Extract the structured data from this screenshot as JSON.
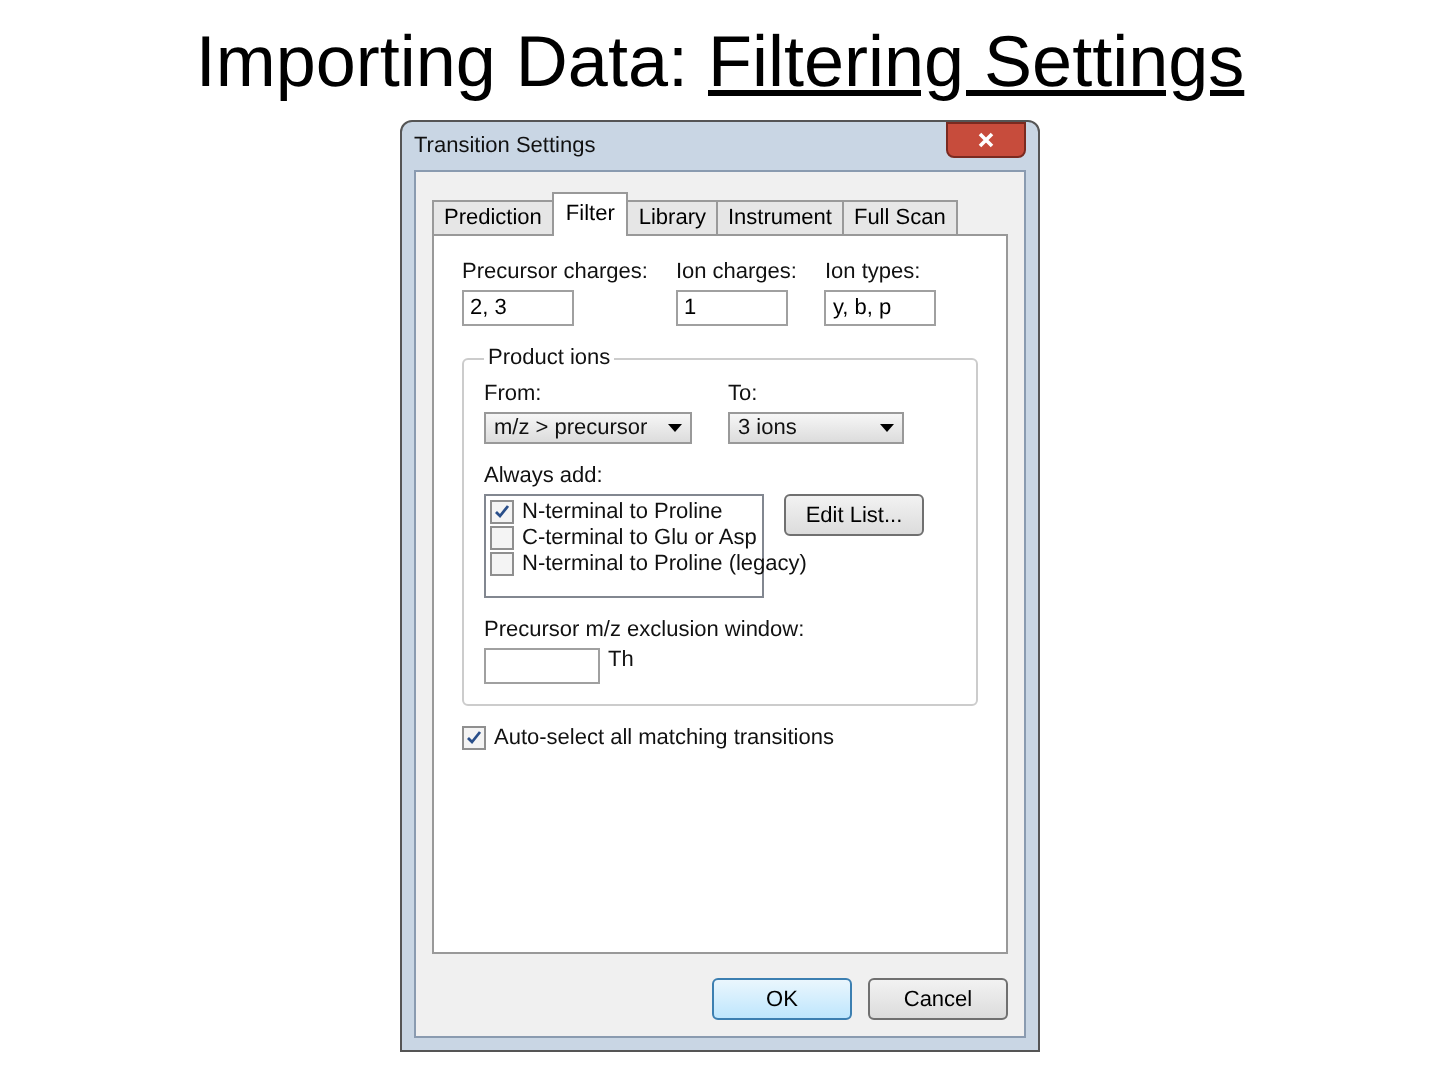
{
  "slide_title": {
    "text": "Importing Data:",
    "link": "Filtering Settings"
  },
  "dialog": {
    "title": "Transition Settings",
    "tabs": [
      {
        "label": "Prediction",
        "selected": false
      },
      {
        "label": "Filter",
        "selected": true
      },
      {
        "label": "Library",
        "selected": false
      },
      {
        "label": "Instrument",
        "selected": false
      },
      {
        "label": "Full Scan",
        "selected": false
      }
    ],
    "fields": [
      {
        "label": "Precursor charges:",
        "value": "2, 3"
      },
      {
        "label": "Ion charges:",
        "value": "1"
      },
      {
        "label": "Ion types:",
        "value": "y, b, p"
      }
    ],
    "product_ions": {
      "title": "Product ions",
      "from": {
        "label": "From:",
        "value": "m/z > precursor"
      },
      "to": {
        "label": "To:",
        "value": "3 ions"
      },
      "always_add": {
        "label": "Always add:",
        "items": [
          {
            "label": "N-terminal to Proline",
            "checked": true
          },
          {
            "label": "C-terminal to Glu or Asp",
            "checked": false
          },
          {
            "label": "N-terminal to Proline (legacy)",
            "checked": false
          }
        ],
        "edit_button": "Edit List..."
      },
      "exclusion": {
        "label": "Precursor m/z exclusion window:",
        "unit": "Th"
      }
    },
    "auto_select": {
      "label": "Auto-select all matching transitions",
      "checked": true
    },
    "buttons": [
      {
        "label": "OK",
        "default": true
      },
      {
        "label": "Cancel",
        "default": false
      }
    ]
  }
}
